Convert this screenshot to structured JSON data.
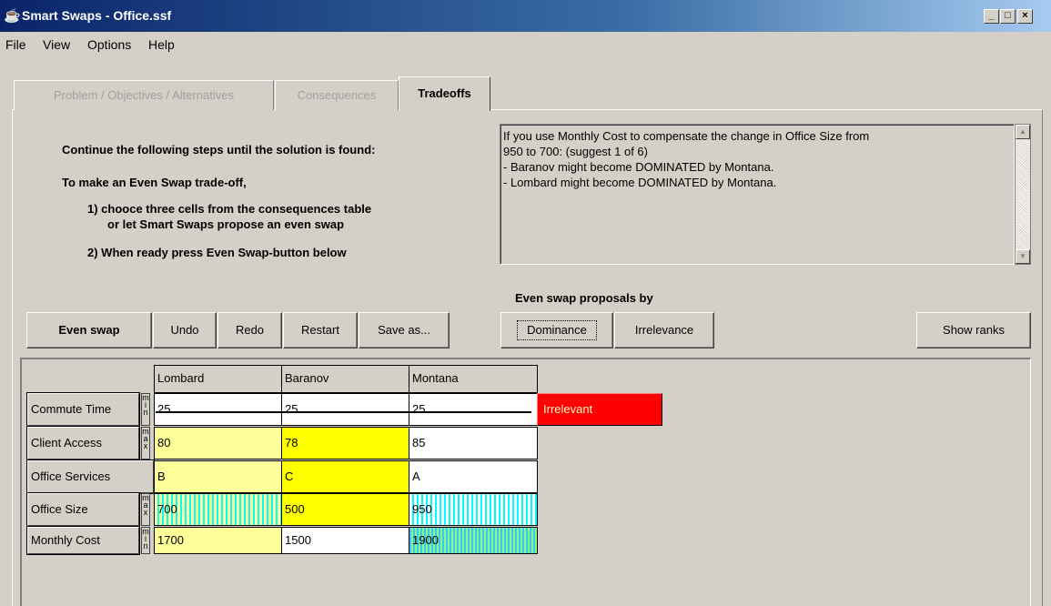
{
  "window": {
    "title": "Smart Swaps - Office.ssf",
    "controls": [
      "_",
      "□",
      "×"
    ]
  },
  "menu": [
    "File",
    "View",
    "Options",
    "Help"
  ],
  "tabs": [
    {
      "label": "Problem / Objectives / Alternatives",
      "state": "disabled"
    },
    {
      "label": "Consequences",
      "state": "disabled"
    },
    {
      "label": "Tradeoffs",
      "state": "active"
    }
  ],
  "instructions": {
    "heading": "Continue the following steps until the solution is found:",
    "line1": "To make an Even Swap trade-off,",
    "step1a": "1) chooce three cells from the consequences table",
    "step1b": "or let Smart Swaps propose an even swap",
    "step2": "2) When ready press Even Swap-button below"
  },
  "info": {
    "lines": [
      "If you use Monthly Cost to compensate the change in Office Size from",
      "950 to 700: (suggest 1 of 6)",
      "-  Baranov might become DOMINATED by Montana.",
      "-  Lombard might become DOMINATED by Montana."
    ]
  },
  "buttons": {
    "even_swap": "Even swap",
    "undo": "Undo",
    "redo": "Redo",
    "restart": "Restart",
    "save_as": "Save as...",
    "dominance": "Dominance",
    "irrelevance": "Irrelevance",
    "show_ranks": "Show ranks"
  },
  "proposals_label": "Even swap proposals by",
  "table": {
    "columns": [
      "Lombard",
      "Baranov",
      "Montana"
    ],
    "rows": [
      {
        "name": "Commute Time",
        "direction": "min",
        "values": [
          "25",
          "25",
          "25"
        ],
        "status": "Irrelevant"
      },
      {
        "name": "Client Access",
        "direction": "max",
        "values": [
          "80",
          "78",
          "85"
        ]
      },
      {
        "name": "Office Services",
        "direction": "",
        "values": [
          "B",
          "C",
          "A"
        ]
      },
      {
        "name": "Office Size",
        "direction": "max",
        "values": [
          "700",
          "500",
          "950"
        ]
      },
      {
        "name": "Monthly Cost",
        "direction": "min",
        "values": [
          "1700",
          "1500",
          "1900"
        ]
      }
    ]
  },
  "colors": {
    "title_bar": "#0a246a",
    "light_yellow": "#ffff99",
    "yellow": "#ffff00",
    "cyan": "#00ffff",
    "green": "#80ff80",
    "irrelevant_red": "#ff0000"
  }
}
